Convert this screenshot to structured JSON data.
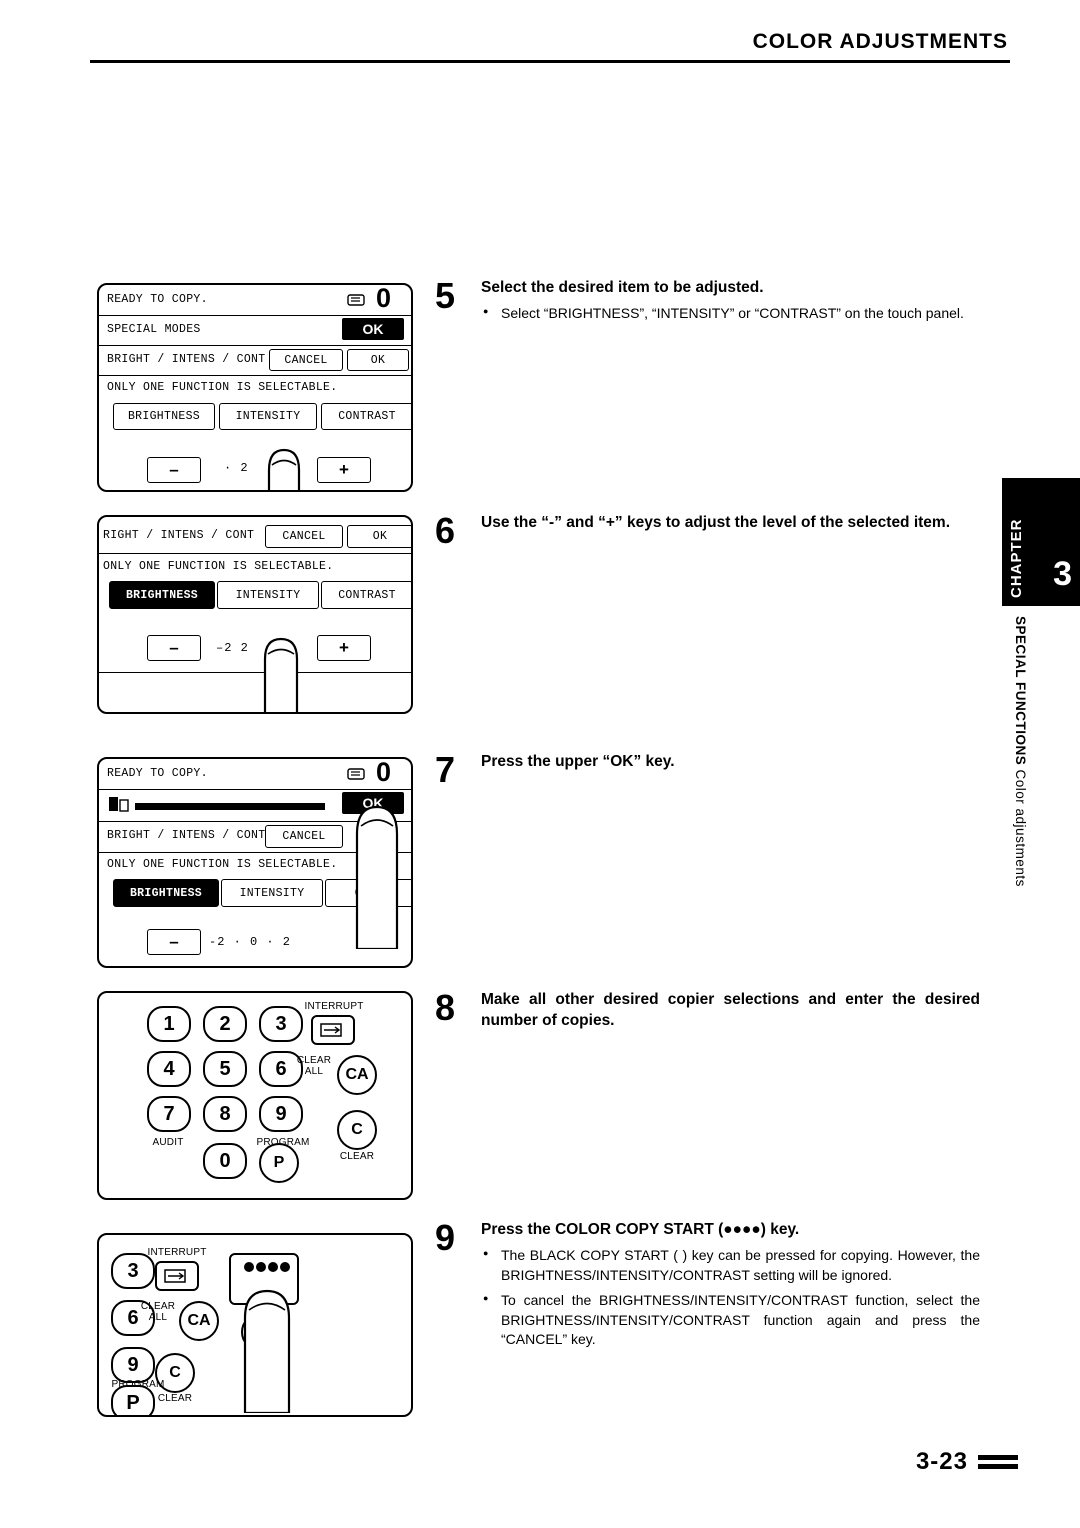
{
  "header": {
    "title": "COLOR ADJUSTMENTS"
  },
  "chapter_tab": {
    "word": "CHAPTER",
    "number": "3",
    "side_bold": "SPECIAL FUNCTIONS",
    "side_thin": "Color adjustments"
  },
  "footer": {
    "page": "3-23"
  },
  "steps": [
    {
      "num": "5",
      "head": "Select the desired item to be adjusted.",
      "bullet": "Select “BRIGHTNESS”, “INTENSITY” or “CONTRAST” on the touch panel."
    },
    {
      "num": "6",
      "head": "Use the “-” and “+” keys to adjust the level of the selected item."
    },
    {
      "num": "7",
      "head": "Press the upper “OK” key."
    },
    {
      "num": "8",
      "head": "Make all other desired copier selections and enter the desired number of copies."
    },
    {
      "num": "9",
      "head": "Press the COLOR COPY START (●●●●) key.",
      "bullet1": "The BLACK COPY START (    ) key can be pressed for copying. However, the BRIGHTNESS/INTENSITY/CONTRAST setting will be ignored.",
      "bullet2": "To cancel the BRIGHTNESS/INTENSITY/CONTRAST function, select the BRIGHTNESS/INTENSITY/CONTRAST function again and press the “CANCEL” key."
    }
  ],
  "panel5": {
    "status": "READY TO COPY.",
    "special_modes": "SPECIAL MODES",
    "ok_top": "OK",
    "tab_label": "BRIGHT / INTENS / CONT",
    "cancel": "CANCEL",
    "ok": "OK",
    "note": "ONLY ONE FUNCTION IS SELECTABLE.",
    "brightness": "BRIGHTNESS",
    "intensity": "INTENSITY",
    "contrast": "CONTRAST",
    "minus": "–",
    "plus": "+",
    "level": "· 2",
    "counter": "0"
  },
  "panel6": {
    "tab_label": "RIGHT / INTENS / CONT",
    "cancel": "CANCEL",
    "ok": "OK",
    "note": "ONLY ONE FUNCTION IS SELECTABLE.",
    "brightness": "BRIGHTNESS",
    "intensity": "INTENSITY",
    "contrast": "CONTRAST",
    "minus": "–",
    "plus": "+",
    "level": "–2   2"
  },
  "panel7": {
    "status": "READY TO COPY.",
    "ok_top": "OK",
    "tab_label": "BRIGHT / INTENS / CONT",
    "cancel": "CANCEL",
    "note": "ONLY ONE FUNCTION IS SELECTABLE.",
    "brightness": "BRIGHTNESS",
    "intensity": "INTENSITY",
    "contrast": "CONT",
    "minus": "–",
    "level": "-2 · 0 · 2",
    "counter": "0"
  },
  "keypad": {
    "keys": [
      "1",
      "2",
      "3",
      "4",
      "5",
      "6",
      "7",
      "8",
      "9",
      "0"
    ],
    "interrupt": "INTERRUPT",
    "clear_all": "CLEAR\nALL",
    "ca": "CA",
    "c": "C",
    "clear": "CLEAR",
    "audit": "AUDIT",
    "program": "PROGRAM",
    "p": "P"
  },
  "keypad2": {
    "k3": "3",
    "k6": "6",
    "k9": "9",
    "interrupt": "INTERRUPT",
    "clear_all": "CLEAR\nALL",
    "ca": "CA",
    "c": "C",
    "clear": "CLEAR",
    "program": "PROGRAM",
    "p": "P"
  }
}
